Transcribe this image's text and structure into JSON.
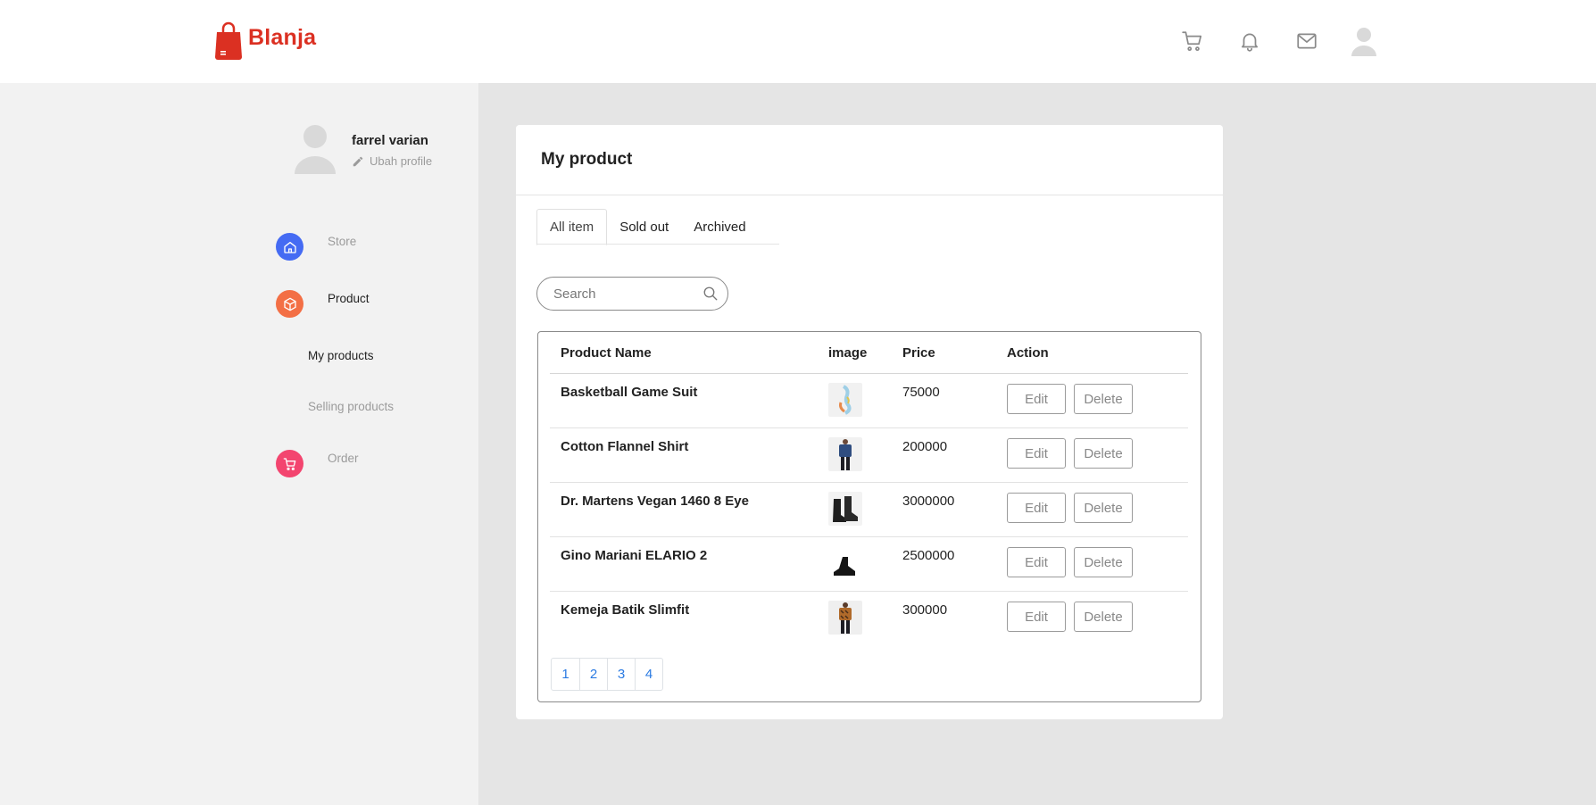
{
  "brand": {
    "name": "Blanja",
    "color": "#db3022"
  },
  "header": {
    "icons": [
      "cart-icon",
      "bell-icon",
      "mail-icon",
      "user-avatar-icon"
    ]
  },
  "sidebar": {
    "profile": {
      "name": "farrel varian",
      "edit_label": "Ubah profile"
    },
    "nav": [
      {
        "label": "Store",
        "icon": "home-icon",
        "color": "#456bf3"
      },
      {
        "label": "Product",
        "icon": "box-icon",
        "color": "#f36f45"
      },
      {
        "label": "Order",
        "icon": "cart-icon",
        "color": "#f3456f"
      }
    ],
    "sub_items": [
      {
        "label": "My products"
      },
      {
        "label": "Selling products"
      }
    ]
  },
  "main": {
    "title": "My product",
    "tabs": [
      {
        "label": "All item"
      },
      {
        "label": "Sold out"
      },
      {
        "label": "Archived"
      }
    ],
    "search": {
      "placeholder": "Search"
    },
    "table": {
      "columns": [
        "Product Name",
        "image",
        "Price",
        "Action"
      ],
      "rows": [
        {
          "name": "Basketball Game Suit",
          "price": "75000",
          "image": "basketball-suit-thumbnail"
        },
        {
          "name": "Cotton Flannel Shirt",
          "price": "200000",
          "image": "flannel-shirt-thumbnail"
        },
        {
          "name": "Dr. Martens Vegan 1460 8 Eye",
          "price": "3000000",
          "image": "boots-thumbnail"
        },
        {
          "name": "Gino Mariani ELARIO 2",
          "price": "2500000",
          "image": "shoe-thumbnail"
        },
        {
          "name": "Kemeja Batik Slimfit",
          "price": "300000",
          "image": "batik-shirt-thumbnail"
        }
      ],
      "edit_label": "Edit",
      "delete_label": "Delete"
    },
    "pagination": [
      "1",
      "2",
      "3",
      "4"
    ]
  }
}
